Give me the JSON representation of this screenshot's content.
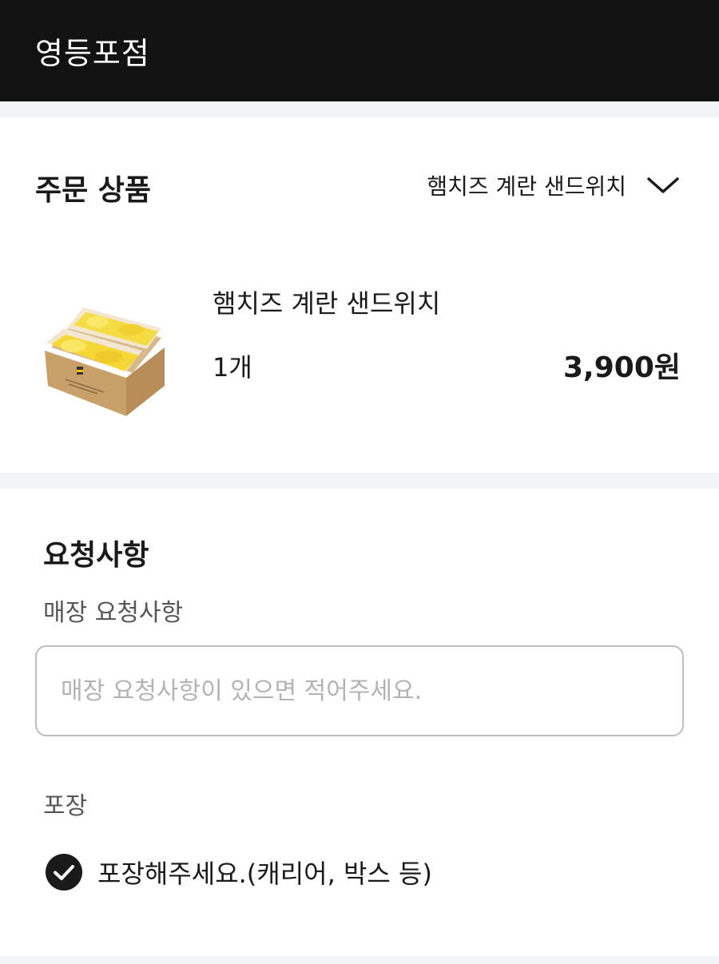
{
  "header": {
    "store_name": "영등포점"
  },
  "order": {
    "heading": "주문 상품",
    "summary_label": "햄치즈 계란 샌드위치",
    "items": [
      {
        "name": "햄치즈 계란 샌드위치",
        "quantity": "1개",
        "price": "3,900원",
        "thumbnail": "egg-sandwich-icon"
      }
    ]
  },
  "request": {
    "heading": "요청사항",
    "store_request_label": "매장 요청사항",
    "store_request_value": "",
    "store_request_placeholder": "매장 요청사항이 있으면 적어주세요.",
    "packaging_label": "포장",
    "packaging_option_label": "포장해주세요.(캐리어, 박스 등)",
    "packaging_checked": true
  },
  "icons": {
    "summary_toggle": "chevron-down-icon",
    "packaging_check": "check-circle-icon"
  },
  "colors": {
    "header_bg": "#121212",
    "divider_bg": "#f2f3f5",
    "check_fill": "#1a1a1a"
  }
}
